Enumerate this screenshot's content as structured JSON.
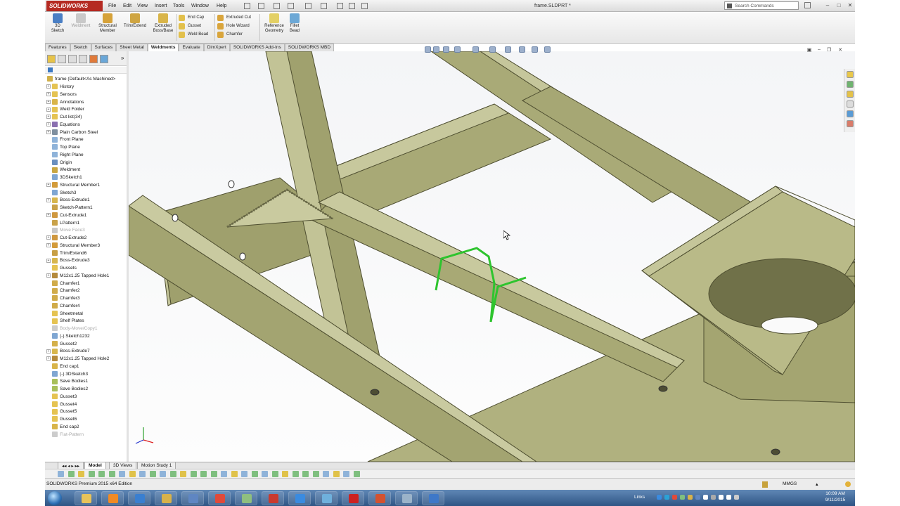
{
  "app": {
    "logo": "SOLIDWORKS",
    "document_title": "frame.SLDPRT *",
    "search_placeholder": "Search Commands"
  },
  "menu": [
    "File",
    "Edit",
    "View",
    "Insert",
    "Tools",
    "Window",
    "Help"
  ],
  "command_manager": {
    "large": [
      {
        "label_line1": "3D",
        "label_line2": "Sketch",
        "color": "#4a7fc4"
      },
      {
        "label_line1": "Weldment",
        "label_line2": "",
        "color": "#b9b9b9"
      },
      {
        "label_line1": "Structural",
        "label_line2": "Member",
        "color": "#d6a23a"
      },
      {
        "label_line1": "Trim/Extend",
        "label_line2": "",
        "color": "#cfa542"
      },
      {
        "label_line1": "Extruded",
        "label_line2": "Boss/Base",
        "color": "#d9b54a"
      }
    ],
    "small_col1": [
      "End Cap",
      "Gusset",
      "Weld Bead"
    ],
    "small_col2": [
      "Extruded Cut",
      "Hole Wizard",
      "Chamfer"
    ],
    "large2": [
      {
        "label_line1": "Reference",
        "label_line2": "Geometry"
      },
      {
        "label_line1": "Fillet",
        "label_line2": "Bead"
      }
    ]
  },
  "tabs": [
    "Features",
    "Sketch",
    "Surfaces",
    "Sheet Metal",
    "Weldments",
    "Evaluate",
    "DimXpert",
    "SOLIDWORKS Add-Ins",
    "SOLIDWORKS MBD"
  ],
  "active_tab": "Weldments",
  "feature_tree": {
    "root": "frame  (Default<As Machined>",
    "items": [
      {
        "label": "History",
        "icon": "folder"
      },
      {
        "label": "Sensors",
        "icon": "folder"
      },
      {
        "label": "Annotations",
        "icon": "annotation"
      },
      {
        "label": "Weld Folder",
        "icon": "folder"
      },
      {
        "label": "Cut list(34)",
        "icon": "folder"
      },
      {
        "label": "Equations",
        "icon": "equation"
      },
      {
        "label": "Plain Carbon Steel",
        "icon": "material"
      },
      {
        "label": "Front Plane",
        "icon": "plane"
      },
      {
        "label": "Top Plane",
        "icon": "plane"
      },
      {
        "label": "Right Plane",
        "icon": "plane"
      },
      {
        "label": "Origin",
        "icon": "origin"
      },
      {
        "label": "Weldment",
        "icon": "weldment"
      },
      {
        "label": "3DSketch1",
        "icon": "sketch"
      },
      {
        "label": "Structural Member1",
        "icon": "member"
      },
      {
        "label": "Sketch3",
        "icon": "sketch"
      },
      {
        "label": "Boss-Extrude1",
        "icon": "extrude"
      },
      {
        "label": "Sketch-Pattern1",
        "icon": "pattern"
      },
      {
        "label": "Cut-Extrude1",
        "icon": "cut"
      },
      {
        "label": "LPattern1",
        "icon": "pattern"
      },
      {
        "label": "Move Face3",
        "icon": "face",
        "grey": true
      },
      {
        "label": "Cut-Extrude2",
        "icon": "cut"
      },
      {
        "label": "Structural Member3",
        "icon": "member"
      },
      {
        "label": "Trim/Extend6",
        "icon": "trim"
      },
      {
        "label": "Boss-Extrude3",
        "icon": "extrude"
      },
      {
        "label": "Gussets",
        "icon": "folder"
      },
      {
        "label": "M12x1.25 Tapped Hole1",
        "icon": "hole"
      },
      {
        "label": "Chamfer1",
        "icon": "chamfer"
      },
      {
        "label": "Chamfer2",
        "icon": "chamfer"
      },
      {
        "label": "Chamfer3",
        "icon": "chamfer"
      },
      {
        "label": "Chamfer4",
        "icon": "chamfer"
      },
      {
        "label": "Sheetmetal",
        "icon": "folder"
      },
      {
        "label": "Shelf Plates",
        "icon": "folder"
      },
      {
        "label": "Body-Move/Copy1",
        "icon": "move",
        "grey": true
      },
      {
        "label": "(-) Sketch1232",
        "icon": "sketch"
      },
      {
        "label": "Gusset2",
        "icon": "gusset"
      },
      {
        "label": "Boss-Extrude7",
        "icon": "extrude"
      },
      {
        "label": "M12x1.25 Tapped Hole2",
        "icon": "hole"
      },
      {
        "label": "End cap1",
        "icon": "endcap"
      },
      {
        "label": "(-) 3DSketch3",
        "icon": "sketch"
      },
      {
        "label": "Save Bodies1",
        "icon": "save"
      },
      {
        "label": "Save Bodies2",
        "icon": "save"
      },
      {
        "label": "Gusset3",
        "icon": "folder"
      },
      {
        "label": "Gusset4",
        "icon": "folder"
      },
      {
        "label": "Gusset5",
        "icon": "folder"
      },
      {
        "label": "Gusset6",
        "icon": "folder"
      },
      {
        "label": "End cap2",
        "icon": "endcap"
      },
      {
        "label": "Flat-Pattern",
        "icon": "flat",
        "grey": true
      }
    ]
  },
  "bottom_tabs": [
    "Model",
    "3D Views",
    "Motion Study 1"
  ],
  "status_bar": {
    "edition": "SOLIDWORKS Premium 2015 x64 Edition",
    "units": "MMGS"
  },
  "taskbar": {
    "links_label": "Links",
    "time": "10:09 AM",
    "date": "9/11/2015"
  },
  "colors": {
    "steel": "#b2b382",
    "steel_dark": "#8a8b5c",
    "steel_light": "#c9caa1",
    "selection": "#3dcc3d"
  }
}
